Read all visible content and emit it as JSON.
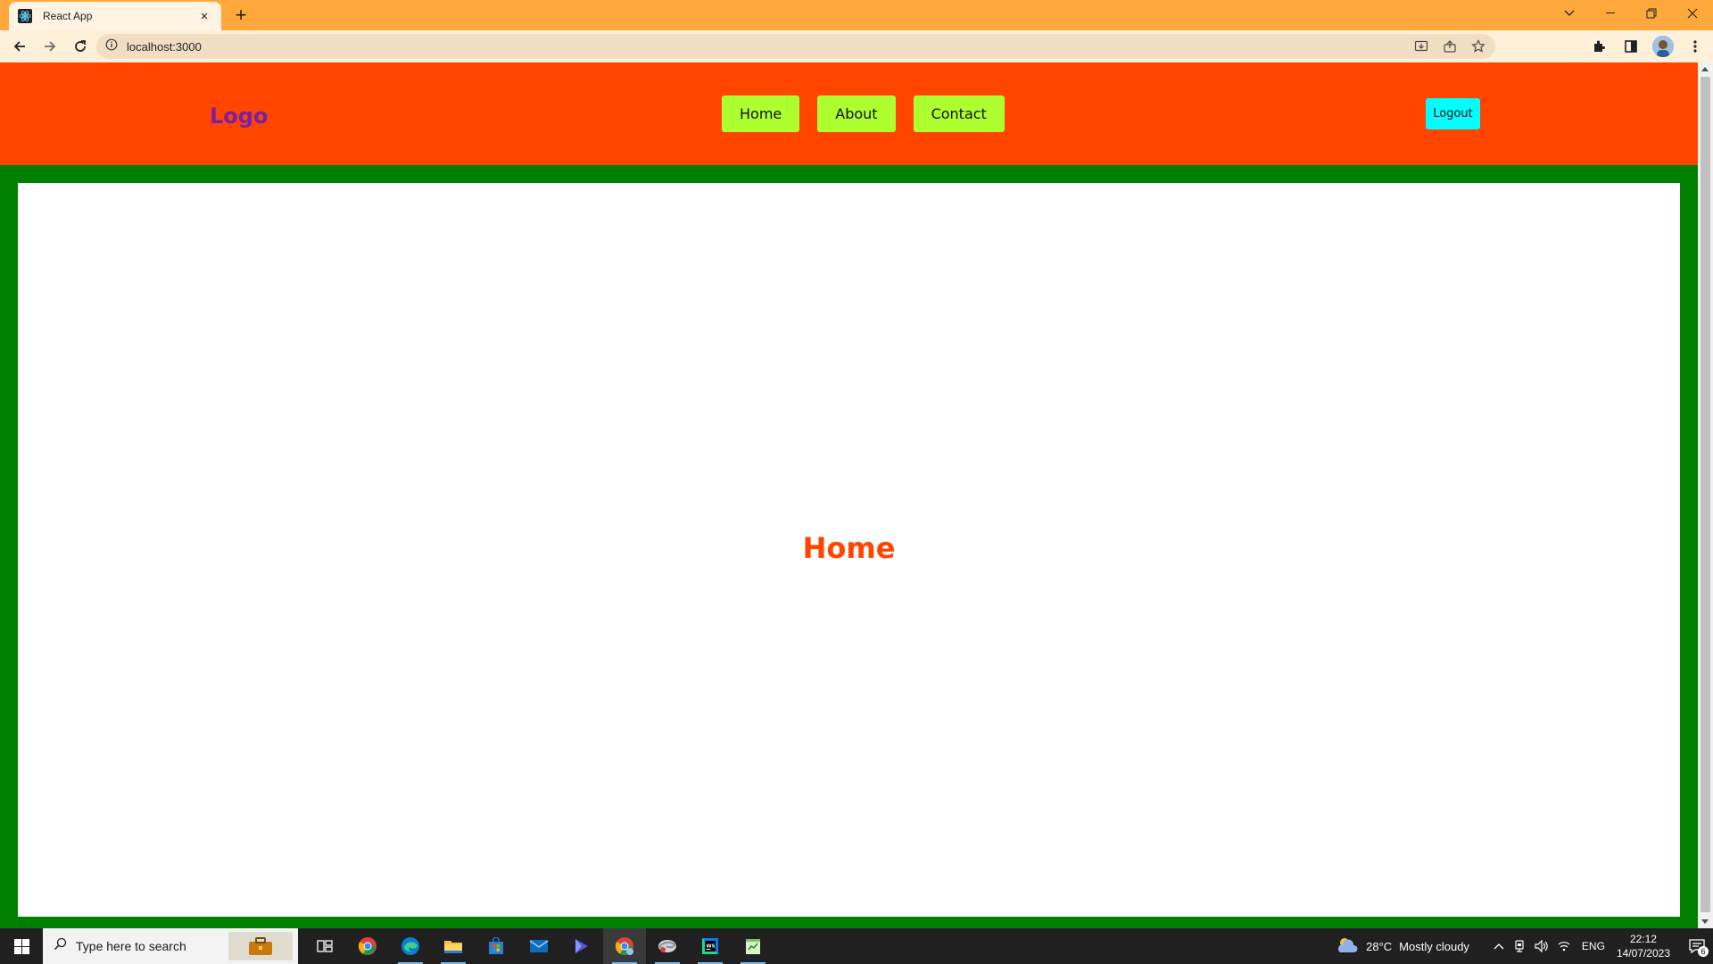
{
  "browser": {
    "tab_title": "React App",
    "url": "localhost:3000",
    "tab_close_glyph": "×",
    "new_tab_glyph": "+"
  },
  "page": {
    "logo": "Logo",
    "nav_links": [
      "Home",
      "About",
      "Contact"
    ],
    "logout_label": "Logout",
    "heading": "Home"
  },
  "taskbar": {
    "search_placeholder": "Type here to search",
    "weather_temp": "28°C",
    "weather_desc": "Mostly cloudy",
    "language": "ENG",
    "time": "22:12",
    "date": "14/07/2023",
    "notification_count": "6"
  },
  "colors": {
    "tabstrip": "#ffa93c",
    "navbar": "#ff4500",
    "page_border": "#008000",
    "nav_button": "#adff2f",
    "logout_button": "#00ffff",
    "logo": "#7a1fa2",
    "heading": "#ff4500"
  },
  "icons": {
    "tab_favicon": "react-icon",
    "window_controls": [
      "tab-search-icon",
      "minimize-icon",
      "restore-icon",
      "close-icon"
    ],
    "toolbar": [
      "back-icon",
      "forward-icon",
      "reload-icon",
      "info-icon"
    ],
    "omnibox": [
      "install-icon",
      "share-icon",
      "bookmark-star-icon"
    ],
    "toolbar_right": [
      "extensions-icon",
      "side-panel-icon",
      "profile-avatar",
      "menu-icon"
    ],
    "taskbar_apps": [
      "task-view-icon",
      "chrome-icon",
      "edge-icon",
      "file-explorer-icon",
      "store-icon",
      "mail-icon",
      "power-automate-icon",
      "chrome-profile-icon",
      "edge-dev-icon",
      "webstorm-icon",
      "notepad-icon"
    ]
  }
}
